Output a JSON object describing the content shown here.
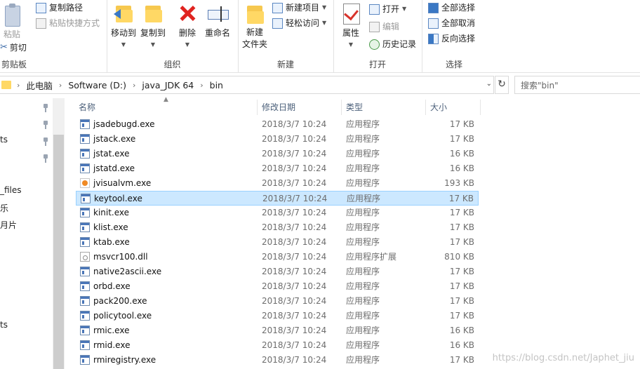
{
  "ribbon": {
    "clipboard": {
      "paste_label": "粘贴",
      "cut_label": "剪切",
      "copy_path_label": "复制路径",
      "paste_shortcut_label": "粘贴快捷方式",
      "group_label": "剪贴板"
    },
    "organize": {
      "move_to_label": "移动到",
      "copy_to_label": "复制到",
      "delete_label": "删除",
      "rename_label": "重命名",
      "group_label": "组织"
    },
    "new": {
      "new_folder_label": "新建\n文件夹",
      "new_item_label": "新建项目",
      "easy_access_label": "轻松访问",
      "group_label": "新建"
    },
    "open": {
      "properties_label": "属性",
      "open_label": "打开",
      "edit_label": "编辑",
      "history_label": "历史记录",
      "group_label": "打开"
    },
    "select": {
      "select_all_label": "全部选择",
      "select_none_label": "全部取消",
      "invert_label": "反向选择",
      "group_label": "选择"
    }
  },
  "address": {
    "crumbs": [
      "此电脑",
      "Software (D:)",
      "java_JDK 64",
      "bin"
    ],
    "search_placeholder": "搜索\"bin\""
  },
  "nav": {
    "items": [
      "ts",
      "_files",
      "乐",
      "月片",
      "ts"
    ]
  },
  "columns": {
    "name": "名称",
    "date": "修改日期",
    "type": "类型",
    "size": "大小"
  },
  "files": [
    {
      "name": "jsadebugd.exe",
      "date": "2018/3/7 10:24",
      "type": "应用程序",
      "size": "17 KB",
      "icon": "exe-icon"
    },
    {
      "name": "jstack.exe",
      "date": "2018/3/7 10:24",
      "type": "应用程序",
      "size": "17 KB",
      "icon": "exe-icon"
    },
    {
      "name": "jstat.exe",
      "date": "2018/3/7 10:24",
      "type": "应用程序",
      "size": "16 KB",
      "icon": "exe-icon"
    },
    {
      "name": "jstatd.exe",
      "date": "2018/3/7 10:24",
      "type": "应用程序",
      "size": "16 KB",
      "icon": "exe-icon"
    },
    {
      "name": "jvisualvm.exe",
      "date": "2018/3/7 10:24",
      "type": "应用程序",
      "size": "193 KB",
      "icon": "jvisualvm-icon"
    },
    {
      "name": "keytool.exe",
      "date": "2018/3/7 10:24",
      "type": "应用程序",
      "size": "17 KB",
      "icon": "exe-icon",
      "selected": true
    },
    {
      "name": "kinit.exe",
      "date": "2018/3/7 10:24",
      "type": "应用程序",
      "size": "17 KB",
      "icon": "exe-icon"
    },
    {
      "name": "klist.exe",
      "date": "2018/3/7 10:24",
      "type": "应用程序",
      "size": "17 KB",
      "icon": "exe-icon"
    },
    {
      "name": "ktab.exe",
      "date": "2018/3/7 10:24",
      "type": "应用程序",
      "size": "17 KB",
      "icon": "exe-icon"
    },
    {
      "name": "msvcr100.dll",
      "date": "2018/3/7 10:24",
      "type": "应用程序扩展",
      "size": "810 KB",
      "icon": "dll-icon"
    },
    {
      "name": "native2ascii.exe",
      "date": "2018/3/7 10:24",
      "type": "应用程序",
      "size": "17 KB",
      "icon": "exe-icon"
    },
    {
      "name": "orbd.exe",
      "date": "2018/3/7 10:24",
      "type": "应用程序",
      "size": "17 KB",
      "icon": "exe-icon"
    },
    {
      "name": "pack200.exe",
      "date": "2018/3/7 10:24",
      "type": "应用程序",
      "size": "17 KB",
      "icon": "exe-icon"
    },
    {
      "name": "policytool.exe",
      "date": "2018/3/7 10:24",
      "type": "应用程序",
      "size": "17 KB",
      "icon": "exe-icon"
    },
    {
      "name": "rmic.exe",
      "date": "2018/3/7 10:24",
      "type": "应用程序",
      "size": "16 KB",
      "icon": "exe-icon"
    },
    {
      "name": "rmid.exe",
      "date": "2018/3/7 10:24",
      "type": "应用程序",
      "size": "16 KB",
      "icon": "exe-icon"
    },
    {
      "name": "rmiregistry.exe",
      "date": "2018/3/7 10:24",
      "type": "应用程序",
      "size": "17 KB",
      "icon": "exe-icon"
    }
  ],
  "watermark": "https://blog.csdn.net/Japhet_jiu",
  "colors": {
    "selection_bg": "#cce8ff",
    "selection_border": "#99d1ff",
    "header_text": "#4c607a",
    "accent": "#3b78c4"
  }
}
